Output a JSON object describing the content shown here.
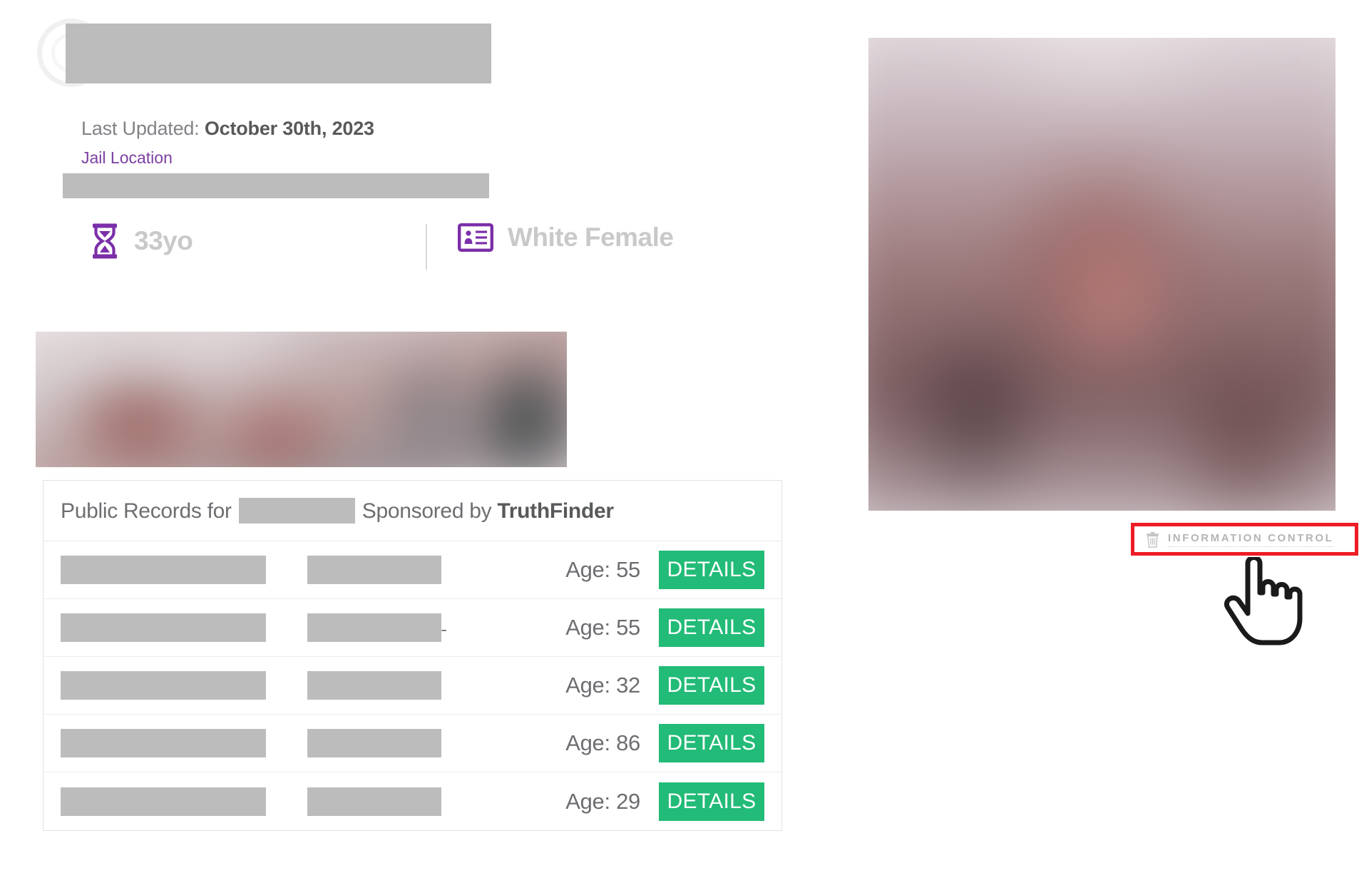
{
  "header": {
    "logo_icon": "circular-ring-logo",
    "title_redacted": true,
    "last_updated_label": "Last Updated:",
    "last_updated_value": "October 30th, 2023",
    "jail_location_link": "Jail Location",
    "jail_location_redacted": true
  },
  "demographics": {
    "age": {
      "icon": "hourglass-icon",
      "text": "33yo"
    },
    "gender": {
      "icon": "id-card-icon",
      "text": "White Female"
    }
  },
  "media": {
    "banner_image": "blurred-banner-photo",
    "portrait_image": "blurred-portrait-photo"
  },
  "records": {
    "header_prefix": "Public Records for",
    "header_middle": "Sponsored by",
    "brand": "TruthFinder",
    "name_redacted": true,
    "details_label": "DETAILS",
    "rows": [
      {
        "name_redacted": true,
        "detail_redacted": true,
        "age": "Age: 55",
        "tail": ""
      },
      {
        "name_redacted": true,
        "detail_redacted": true,
        "age": "Age: 55",
        "tail": "-"
      },
      {
        "name_redacted": true,
        "detail_redacted": true,
        "age": "Age: 32",
        "tail": ""
      },
      {
        "name_redacted": true,
        "detail_redacted": true,
        "age": "Age: 86",
        "tail": ""
      },
      {
        "name_redacted": true,
        "detail_redacted": true,
        "age": "Age: 29",
        "tail": ""
      }
    ]
  },
  "information_control": {
    "label": "INFORMATION CONTROL",
    "icon": "trash-icon",
    "highlight_color": "#ee1c25",
    "highlighted": true
  },
  "cursor": {
    "type": "pointing-hand-cursor"
  },
  "colors": {
    "accent_purple": "#7b3fa0",
    "details_green": "#22bb77",
    "redaction_gray": "#bcbcbc",
    "highlight_red": "#ee1c25"
  }
}
